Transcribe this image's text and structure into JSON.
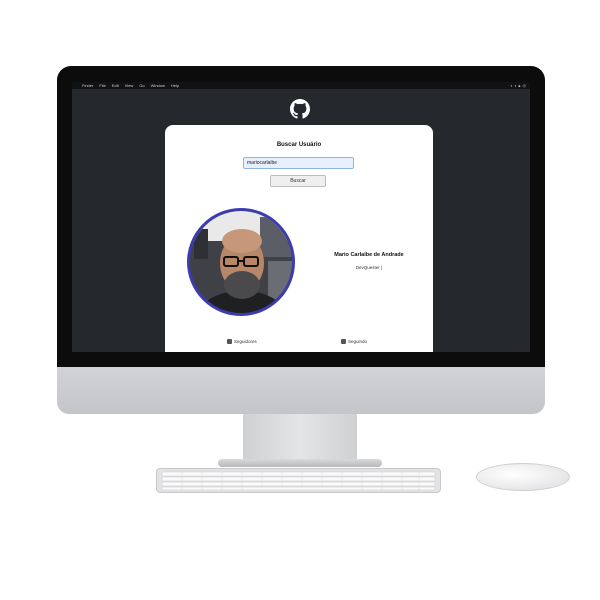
{
  "menubar": {
    "items": [
      "Finder",
      "File",
      "Edit",
      "View",
      "Go",
      "Window",
      "Help"
    ]
  },
  "icons": {
    "logo": "github-icon",
    "followers": "people-icon",
    "following": "people-icon"
  },
  "search": {
    "title": "Buscar Usuário",
    "value": "mariocarlaibe",
    "button_label": "Buscar"
  },
  "profile": {
    "name": "Mario Carlaibe de Andrade",
    "bio": "DevQuester |"
  },
  "stats": {
    "followers_label": "Seguidores",
    "following_label": "Seguindo"
  },
  "colors": {
    "screen_bg": "#25282c",
    "card_bg": "#ffffff",
    "avatar_border": "#3c3cb0",
    "input_bg": "#e8f0fe"
  }
}
